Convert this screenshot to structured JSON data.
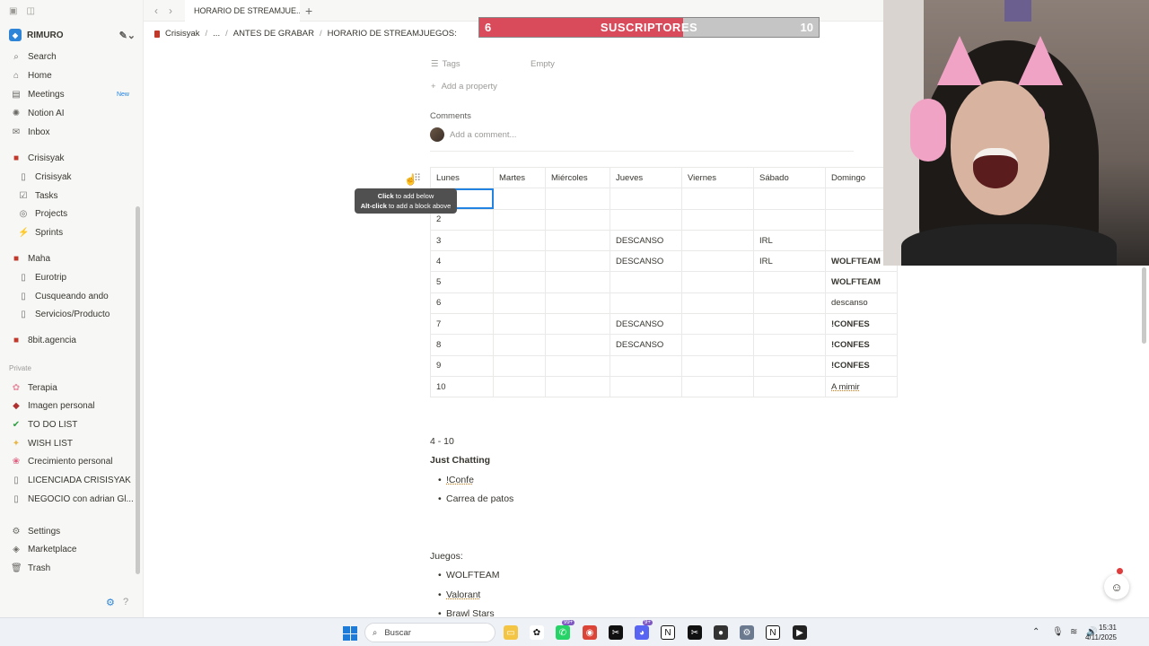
{
  "tab": {
    "title": "HORARIO DE STREAMJUE..."
  },
  "breadcrumb": [
    "Crisisyak",
    "...",
    "ANTES DE GRABAR",
    "HORARIO DE STREAMJUEGOS:"
  ],
  "workspace": {
    "name": "RIMURO"
  },
  "sidebar": {
    "top_items": [
      {
        "label": "Search",
        "icon": "search-icon"
      },
      {
        "label": "Home",
        "icon": "home-icon"
      },
      {
        "label": "Meetings",
        "icon": "meetings-icon",
        "badge": "New"
      },
      {
        "label": "Notion AI",
        "icon": "notion-ai-icon"
      },
      {
        "label": "Inbox",
        "icon": "inbox-icon"
      }
    ],
    "teamspaces": [
      {
        "label": "Crisisyak",
        "icon": "teamspace-icon",
        "sub": false
      },
      {
        "label": "Crisisyak",
        "icon": "page-icon",
        "sub": true
      },
      {
        "label": "Tasks",
        "icon": "checkbox-icon",
        "sub": true
      },
      {
        "label": "Projects",
        "icon": "projects-icon",
        "sub": true
      },
      {
        "label": "Sprints",
        "icon": "sprints-icon",
        "sub": true
      },
      {
        "label": "Maha",
        "icon": "teamspace-icon",
        "sub": false
      },
      {
        "label": "Eurotrip",
        "icon": "page-icon",
        "sub": true
      },
      {
        "label": "Cusqueando ando",
        "icon": "page-icon",
        "sub": true
      },
      {
        "label": "Servicios/Producto",
        "icon": "page-icon",
        "sub": true
      },
      {
        "label": "8bit.agencia",
        "icon": "teamspace-icon",
        "sub": false
      }
    ],
    "private_label": "Private",
    "private_items": [
      {
        "label": "Terapia",
        "icon": "brain-icon"
      },
      {
        "label": "Imagen personal",
        "icon": "lipstick-icon"
      },
      {
        "label": "TO DO LIST",
        "icon": "check-icon"
      },
      {
        "label": "WISH LIST",
        "icon": "star-icon"
      },
      {
        "label": "Crecimiento personal",
        "icon": "flower-icon"
      },
      {
        "label": "LICENCIADA CRISISYAK",
        "icon": "page-icon"
      },
      {
        "label": "NEGOCIO con adrian Gl...",
        "icon": "page-icon"
      }
    ],
    "bottom_items": [
      {
        "label": "Settings",
        "icon": "gear-icon"
      },
      {
        "label": "Marketplace",
        "icon": "marketplace-icon"
      },
      {
        "label": "Trash",
        "icon": "trash-icon"
      }
    ]
  },
  "overlay": {
    "left_value": "6",
    "label": "SUSCRIPTORES",
    "right_value": "10",
    "progress": 0.6
  },
  "properties": {
    "tags_label": "Tags",
    "tags_value": "Empty",
    "add_property": "Add a property",
    "comments_label": "Comments",
    "comment_placeholder": "Add a comment..."
  },
  "tooltip": {
    "line1_bold": "Click",
    "line1": "to add below",
    "line2_bold": "Alt-click",
    "line2": "to add a block above"
  },
  "table": {
    "headers": [
      "Lunes",
      "Martes",
      "Miércoles",
      "Jueves",
      "Viernes",
      "Sábado",
      "Domingo"
    ],
    "rows": [
      [
        "",
        "",
        "",
        "",
        "",
        "",
        ""
      ],
      [
        "2",
        "",
        "",
        "",
        "",
        "",
        ""
      ],
      [
        "3",
        "",
        "",
        "DESCANSO",
        "",
        "IRL",
        ""
      ],
      [
        "4",
        "",
        "",
        "DESCANSO",
        "",
        "IRL",
        "WOLFTEAM"
      ],
      [
        "5",
        "",
        "",
        "",
        "",
        "",
        "WOLFTEAM"
      ],
      [
        "6",
        "",
        "",
        "",
        "",
        "",
        "descanso"
      ],
      [
        "7",
        "",
        "",
        "DESCANSO",
        "",
        "",
        "!CONFES"
      ],
      [
        "8",
        "",
        "",
        "DESCANSO",
        "",
        "",
        "!CONFES"
      ],
      [
        "9",
        "",
        "",
        "",
        "",
        "",
        "!CONFES"
      ],
      [
        "10",
        "",
        "",
        "",
        "",
        "",
        "A mimir"
      ]
    ]
  },
  "body": {
    "range": "4 - 10",
    "just_chatting": "Just Chatting",
    "jc_items": [
      "!Confe",
      "Carrea de patos"
    ],
    "juegos": "Juegos:",
    "game_items": [
      "WOLFTEAM",
      "Valorant",
      "Brawl Stars"
    ]
  },
  "taskbar": {
    "search_placeholder": "Buscar",
    "time": "15:31",
    "date": "4/11/2025",
    "badge_count": "99+",
    "badge_small": "9+"
  }
}
